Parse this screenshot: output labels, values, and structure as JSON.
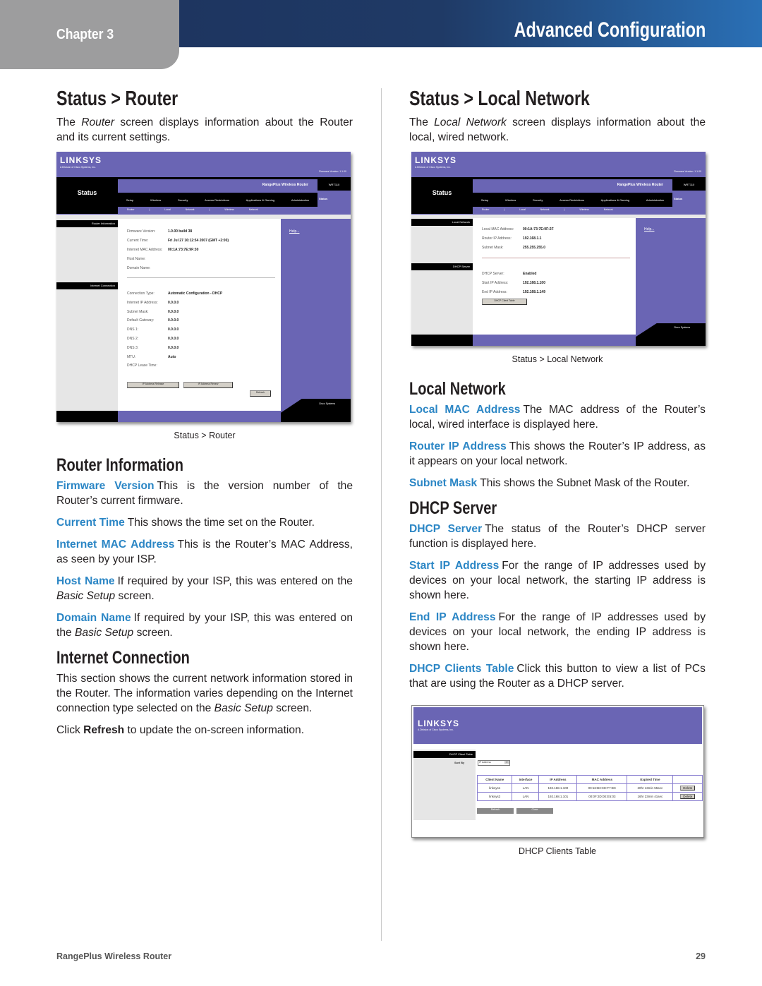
{
  "header": {
    "chapter": "Chapter 3",
    "section": "Advanced Configuration"
  },
  "left": {
    "title": "Status > Router",
    "intro": [
      "The ",
      "Router",
      " screen displays information about the Router and its current settings."
    ],
    "caption": "Status > Router",
    "router_info_heading": "Router Information",
    "router_info_items": [
      {
        "term": "Firmware Version",
        "desc": "This is the version number of the Router’s current firmware."
      },
      {
        "term": "Current Time",
        "desc": "This shows the time set on the Router."
      },
      {
        "term": "Internet MAC Address",
        "desc": "This is the Router’s MAC Address, as seen by your ISP."
      },
      {
        "term": "Host Name",
        "desc": "If required by your ISP, this was entered on the ",
        "em": "Basic Setup",
        "tail": " screen."
      },
      {
        "term": "Domain Name",
        "desc": "If required by your ISP, this was entered on the ",
        "em": "Basic Setup",
        "tail": " screen."
      }
    ],
    "internet_heading": "Internet Connection",
    "internet_para": [
      "This section shows the current network information stored in the Router. The information varies depending on the Internet connection type selected on the ",
      "Basic Setup",
      " screen."
    ],
    "refresh_para": [
      "Click ",
      "Refresh",
      " to update the on-screen information."
    ]
  },
  "right": {
    "title": "Status > Local Network",
    "intro": [
      "The ",
      "Local Network",
      " screen displays information about the local, wired network."
    ],
    "caption": "Status > Local Network",
    "local_heading": "Local Network",
    "local_items": [
      {
        "term": "Local MAC Address",
        "desc": "The MAC address of the Router’s local, wired interface is displayed here."
      },
      {
        "term": "Router IP Address",
        "desc": "This shows the Router’s IP address, as it appears on your local network."
      },
      {
        "term": "Subnet Mask",
        "desc": "This shows the Subnet Mask of the Router."
      }
    ],
    "dhcp_heading": "DHCP Server",
    "dhcp_items": [
      {
        "term": "DHCP Server",
        "desc": "The status of the Router’s DHCP server function is displayed here."
      },
      {
        "term": "Start IP Address",
        "desc": "For the range of IP addresses used by devices on your local network, the starting IP address is shown here."
      },
      {
        "term": "End IP Address",
        "desc": "For the range of IP addresses used by devices on your local network, the ending IP address is shown here."
      },
      {
        "term": "DHCP Clients Table",
        "desc": "Click this button to view a list of PCs that are using the Router as a DHCP server."
      }
    ],
    "caption2": "DHCP Clients Table"
  },
  "shot_common": {
    "logo": "LINKSYS",
    "logo_sub": "A Division of Cisco Systems, Inc.",
    "firmware": "Firmware Version: 1.1.00",
    "product": "RangePlus Wireless Router",
    "model": "WRT110",
    "page": "Status",
    "tabs": [
      "Setup",
      "Wireless",
      "Security",
      "Access Restrictions",
      "Applications & Gaming",
      "Administration",
      "Status"
    ],
    "subtabs": [
      "Router",
      "Local Network",
      "Wireless Network"
    ],
    "help": "Help...",
    "cisco": "Cisco Systems"
  },
  "router_shot": {
    "sec1": "Router Information",
    "sec2": "Internet Connection",
    "rows1": [
      [
        "Firmware Version:",
        "1.0.00 build 38"
      ],
      [
        "Current Time:",
        "Fri Jul 27 16:12:54 2007 (GMT +2:00)"
      ],
      [
        "Internet MAC Address:",
        "00:1A:73:7E:9F:30"
      ],
      [
        "Host Name:",
        ""
      ],
      [
        "Domain Name:",
        ""
      ]
    ],
    "rows2": [
      [
        "Connection Type:",
        "Automatic Configuration - DHCP"
      ],
      [
        "Internet IP Address:",
        "0.0.0.0"
      ],
      [
        "Subnet Mask:",
        "0.0.0.0"
      ],
      [
        "Default Gateway:",
        "0.0.0.0"
      ],
      [
        "DNS 1:",
        "0.0.0.0"
      ],
      [
        "DNS 2:",
        "0.0.0.0"
      ],
      [
        "DNS 3:",
        "0.0.0.0"
      ],
      [
        "MTU:",
        "Auto"
      ],
      [
        "DHCP Lease Time:",
        ""
      ]
    ],
    "btn_release": "IP Address Release",
    "btn_renew": "IP Address Renew",
    "btn_refresh": "Refresh"
  },
  "local_shot": {
    "sec1": "Local Network",
    "sec2": "DHCP Server",
    "rows1": [
      [
        "Local MAC Address:",
        "00:1A:73:7E:9F:2F"
      ],
      [
        "Router IP Address:",
        "192.168.1.1"
      ],
      [
        "Subnet Mask:",
        "255.255.255.0"
      ]
    ],
    "rows2": [
      [
        "DHCP Server:",
        "Enabled"
      ],
      [
        "Start IP Address:",
        "192.168.1.100"
      ],
      [
        "End IP Address:",
        "192.168.1.149"
      ]
    ],
    "btn_table": "DHCP Client Table"
  },
  "dhcp_shot": {
    "sec": "DHCP Client Table",
    "sort_label": "Sort By",
    "sort_value": "IP Address",
    "headers": [
      "Client Name",
      "Interface",
      "IP Address",
      "MAC Address",
      "Expired Time",
      ""
    ],
    "rows": [
      [
        "linksys1",
        "LAN",
        "192.168.1.100",
        "00:16:B3:CE:F7:BC",
        "20hr 13min 55sec",
        "Delete"
      ],
      [
        "linksys2",
        "LAN",
        "192.168.1.101",
        "00:0F:3D:0E:E5:03",
        "16hr 23min 41sec",
        "Delete"
      ]
    ],
    "btn_refresh": "Refresh",
    "btn_close": "Close"
  },
  "footer": {
    "product": "RangePlus Wireless Router",
    "page": "29"
  },
  "colors": {
    "header_dark": "#1e3560",
    "header_light": "#2a70b6",
    "term": "#2b86c5",
    "tab_gray": "#9d9d9e",
    "shot_purple": "#6a65b4"
  }
}
